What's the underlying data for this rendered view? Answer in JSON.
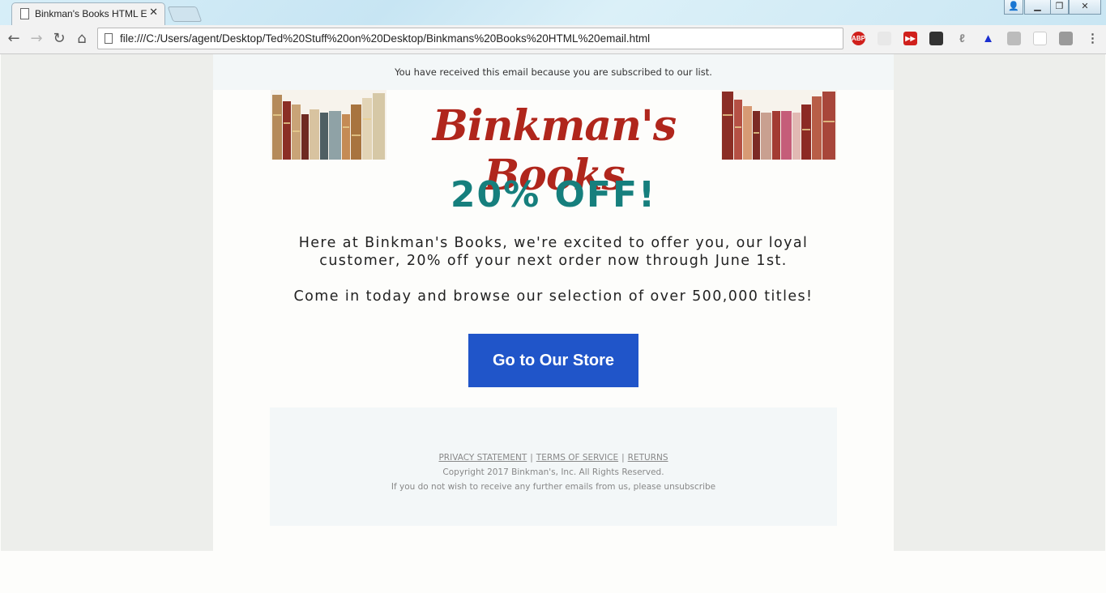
{
  "browser": {
    "tab_title": "Binkman's Books HTML E",
    "url": "file:///C:/Users/agent/Desktop/Ted%20Stuff%20on%20Desktop/Binkmans%20Books%20HTML%20email.html",
    "extensions": [
      "adblock-plus-icon",
      "share-icon",
      "fast-forward-icon",
      "glasses-icon",
      "feather-icon",
      "triangle-icon",
      "abc-icon",
      "blank-icon",
      "lock-icon",
      "menu-icon"
    ]
  },
  "email": {
    "preheader": "You have received this email because you are subscribed to our list.",
    "logo_text": "Binkman's Books",
    "headline": "20% OFF!",
    "paragraph1": "Here at Binkman's Books, we're excited to offer you, our loyal customer, 20% off your next order now through June 1st.",
    "paragraph2": "Come in today and browse our selection of over 500,000 titles!",
    "cta_label": "Go to Our Store",
    "footer": {
      "privacy": "PRIVACY STATEMENT",
      "terms": "TERMS OF SERVICE",
      "returns": "RETURNS",
      "separator": "|",
      "copyright": "Copyright 2017 Binkman's, Inc. All Rights Reserved.",
      "unsubscribe": "If you do not wish to receive any further emails from us, please unsubscribe"
    }
  },
  "colors": {
    "logo": "#b0261c",
    "headline": "#167f7d",
    "cta": "#2055c9"
  }
}
